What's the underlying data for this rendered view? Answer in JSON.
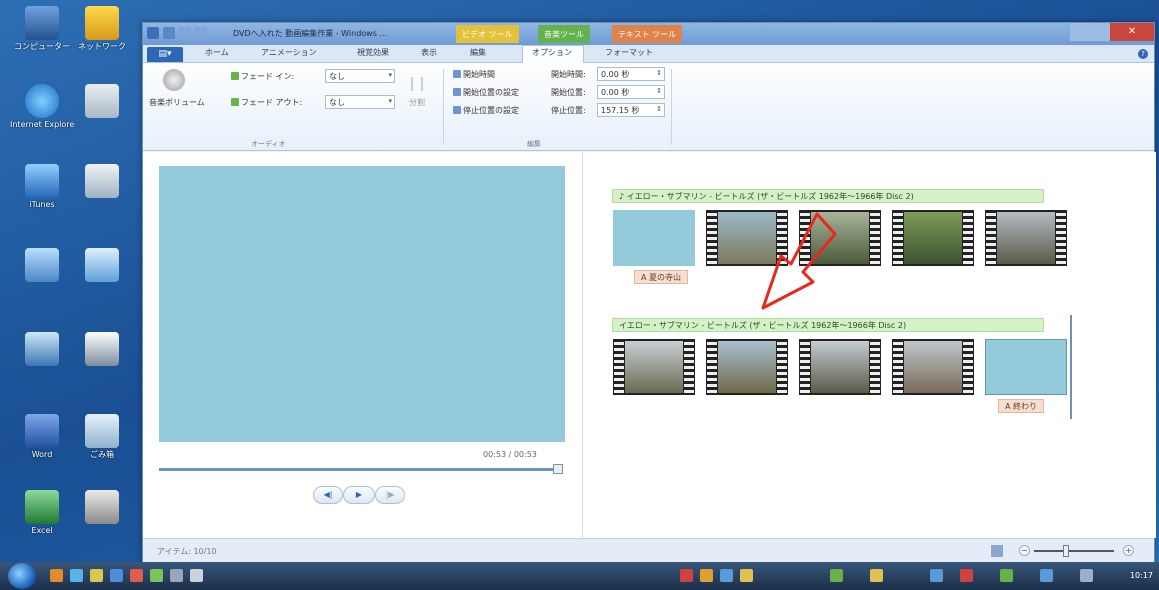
{
  "window": {
    "title": "DVDへ入れた 動画編集作業 - Windows ...",
    "context_tabs": [
      "ビデオ ツール",
      "音楽ツール",
      "テキスト ツール"
    ]
  },
  "ribbon_tabs": [
    "ホーム",
    "アニメーション",
    "視覚効果",
    "表示",
    "編集",
    "オプション",
    "フォーマット"
  ],
  "audio_group": {
    "label": "オーディオ",
    "music_volume": "音楽ボリューム",
    "fade_in_label": "フェード イン:",
    "fade_in_value": "なし",
    "fade_out_label": "フェード アウト:",
    "fade_out_value": "なし",
    "split": "分割"
  },
  "edit_group": {
    "label": "編集",
    "set_start_time": "開始時間",
    "set_start_point": "開始位置の設定",
    "set_end_point": "停止位置の設定",
    "start_time_label": "開始時間:",
    "start_time_value": "0.00 秒",
    "start_point_label": "開始位置:",
    "start_point_value": "0.00 秒",
    "end_point_label": "停止位置:",
    "end_point_value": "157.15 秒"
  },
  "preview": {
    "timecode": "00:53 / 00:53",
    "progress": 0.98
  },
  "storyboard": {
    "music_1": "♪ イエロー・サブマリン - ビートルズ (ザ・ビートルズ 1962年〜1966年 Disc 2)",
    "music_2": "イエロー・サブマリン - ビートルズ (ザ・ビートルズ 1962年〜1966年 Disc 2)",
    "caption_1": "A 夏の寺山",
    "caption_2": "A 終わり"
  },
  "status": {
    "items": "アイテム: 10/10"
  },
  "desktop_icons": [
    "コンピューター",
    "ネットワーク",
    "Internet Explorer",
    "",
    "iTunes",
    "",
    "",
    "",
    "",
    "",
    "Word",
    "ごみ箱",
    "Excel",
    ""
  ],
  "taskbar": {
    "clock": "10:17"
  },
  "colors": {
    "preview_bg": "#93cad9",
    "music_bar": "#d6f0c7",
    "caption": "#f6ded0",
    "arrow": "#e8281f"
  }
}
